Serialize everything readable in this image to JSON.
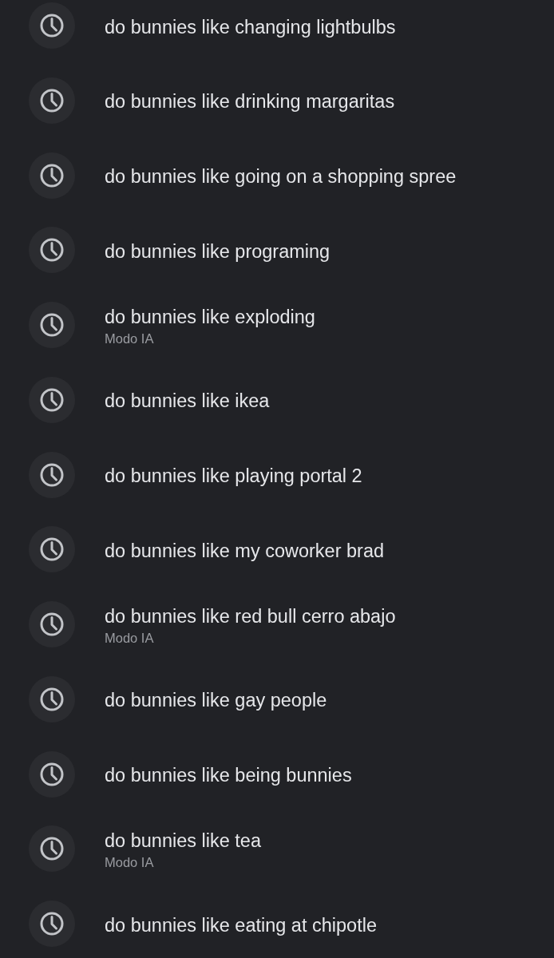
{
  "history": [
    {
      "query": "do bunnies like changing lightbulbs"
    },
    {
      "query": "do bunnies like drinking margaritas"
    },
    {
      "query": "do bunnies like going on a shopping spree"
    },
    {
      "query": "do bunnies like programing"
    },
    {
      "query": "do bunnies like exploding",
      "subtitle": "Modo IA"
    },
    {
      "query": "do bunnies like ikea"
    },
    {
      "query": "do bunnies like playing portal 2"
    },
    {
      "query": "do bunnies like my coworker brad"
    },
    {
      "query": "do bunnies like red bull cerro abajo",
      "subtitle": "Modo IA"
    },
    {
      "query": "do bunnies like gay people"
    },
    {
      "query": "do bunnies like being bunnies"
    },
    {
      "query": "do bunnies like tea",
      "subtitle": "Modo IA"
    },
    {
      "query": "do bunnies like eating at chipotle"
    }
  ]
}
